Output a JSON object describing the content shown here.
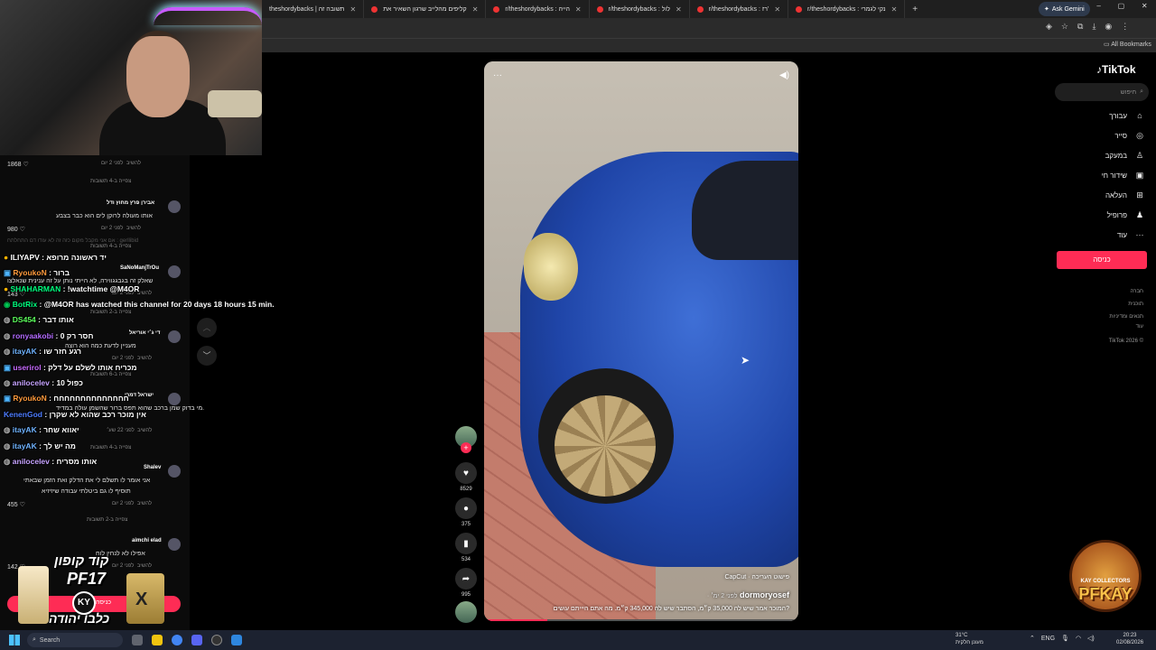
{
  "browser": {
    "tabs": [
      {
        "label": "theshordybacks | תשובה זה"
      },
      {
        "label": "קליפים מהלייב שרגון השאיר את"
      },
      {
        "label": "r/theshordybacks : הייה"
      },
      {
        "label": "r/theshordybacks : לול"
      },
      {
        "label": "r/theshordybacks : רז'"
      },
      {
        "label": "r/theshordybacks : נקי לגמרי"
      }
    ],
    "new_tab": "+",
    "gemini": "Ask Gemini",
    "all_bookmarks": "All Bookmarks",
    "window_controls": [
      "–",
      "▢",
      "✕"
    ]
  },
  "chat": {
    "comments": [
      {
        "likes": "1868",
        "time": "לפני 2 יום",
        "reply": "להשיב"
      },
      {
        "view_replies": "צפייה ב-4 תשובות"
      },
      {
        "author": "אבירן פרץ מחוץ ודל",
        "text": "אותו מעולה לרוקן לים הוא כבר בצבע",
        "likes": "980",
        "time": "לפני 2 יום",
        "reply": "להשיב"
      },
      {
        "view_replies": "צפייה ב-4 תשובות"
      },
      {
        "author": "SaNoManjTrOu",
        "text": "שאלק זה בגבגגווירה, לא הייתי נותן על זה ענינית שנאלצו",
        "likes": "143",
        "time": "לפני 2 יום",
        "reply": "להשיב"
      },
      {
        "view_replies": "צפייה ב-2 תשובות"
      },
      {
        "author": "די ג׳י אוריאל",
        "text": "מעניין לדעת כמה הוא רוצה",
        "time": "לפני 2 יום",
        "reply": "להשיב"
      },
      {
        "view_replies": "צפייה ב-6 תשובות"
      },
      {
        "author": "ישראל דמרי",
        "text": "מי בדוק שמן ברכב שהוא תפס ברור שהשמן עולה במדיד.",
        "time": "לפני 22 שע׳",
        "reply": "להשיב"
      },
      {
        "view_replies": "צפייה ב-4 תשובות"
      },
      {
        "author": "Shalev",
        "text": "אני אומר לו תשלם לי את הדלק ואת הזמן שבאתי",
        "text2": "תוסיף לו גם ביטלתי עבודה שיזיזיא",
        "likes": "455",
        "time": "לפני 2 יום",
        "reply": "להשיב"
      },
      {
        "view_replies": "צפייה ב-2 תשובות"
      },
      {
        "author": "aimchi elad",
        "text": "אפילו לא לנחין לוח",
        "likes": "142",
        "time": "לפני 2 יום",
        "reply": "להשיב"
      }
    ],
    "twitch": [
      {
        "user": "ILIYAPV",
        "msg": "יד ראשונה מרופא"
      },
      {
        "user": "RyoukoN",
        "msg": "ברור"
      },
      {
        "user": "SHAHARMAN",
        "msg": "!watchtime @M4OR"
      },
      {
        "user": "BotRix",
        "msg": "@M4OR has watched this channel for 20 days 18 hours 15 min."
      },
      {
        "user": "DS454",
        "msg": "אותו דבר"
      },
      {
        "user": "ronyaakobi",
        "msg": "חסר רק 0"
      },
      {
        "user": "itayAK",
        "msg": "רגע חזר שו"
      },
      {
        "user": "userirol",
        "msg": "מכריח אותו לשלם על דלק"
      },
      {
        "user": "anilocelev",
        "msg": "כפול 10"
      },
      {
        "user": "RyoukoN",
        "msg": "חחחחחחחחחחחחחח"
      },
      {
        "user": "KenenGod",
        "msg": "אין מוכר רכב שהוא לא שקרן"
      },
      {
        "user": "itayAK",
        "msg": "יאווא שחר"
      },
      {
        "user": "itayAK",
        "msg": "מה יש לך"
      },
      {
        "user": "anilocelev",
        "msg": "אותו מסריח"
      }
    ],
    "stray": "אם אני מקבל מקום כזה זה לא עודו דם התחלתח : gerllibid"
  },
  "video": {
    "author": "dormoryosef",
    "time": "· לפני 2 ימ׳",
    "capcut": "CapCut · פישוט העריכה",
    "caption": "המוכר אמר שיש לה 35,000 ק״מ, הסתבר שיש לה 345,000 ק״מ. מה אתם היייתם עושים?",
    "progress": 0.2,
    "dots": "···",
    "volume": "◀)"
  },
  "actions": {
    "likes": "8529",
    "comments": "375",
    "saves": "534",
    "shares": "995"
  },
  "tiktok": {
    "logo": "TikTok",
    "search_placeholder": "חיפוש",
    "nav": [
      {
        "label": "עבורך",
        "icon": "home-icon"
      },
      {
        "label": "סייר",
        "icon": "compass-icon"
      },
      {
        "label": "במעקב",
        "icon": "following-icon"
      },
      {
        "label": "שידור חי",
        "icon": "live-icon"
      },
      {
        "label": "העלאה",
        "icon": "upload-icon"
      },
      {
        "label": "פרופיל",
        "icon": "profile-icon"
      },
      {
        "label": "עוד",
        "icon": "more-icon"
      }
    ],
    "login": "כניסה",
    "footer": [
      "חברה",
      "תוכנית",
      "תנאים ומדיניות",
      "עוד",
      "TikTok 2026 ©"
    ]
  },
  "promo": {
    "line1": "קוד קופון",
    "code": "PF17",
    "ky": "KY",
    "bar": "כניסה",
    "line2": "כלבו יהודה"
  },
  "badge": {
    "sub": "KAY COLLECTORS",
    "main": "PFKAY"
  },
  "taskbar": {
    "search": "Search",
    "weather_temp": "31°C",
    "weather_desc": "מעונן חלקית",
    "lang": "ENG",
    "time": "20:23",
    "date": "02/08/2026"
  }
}
